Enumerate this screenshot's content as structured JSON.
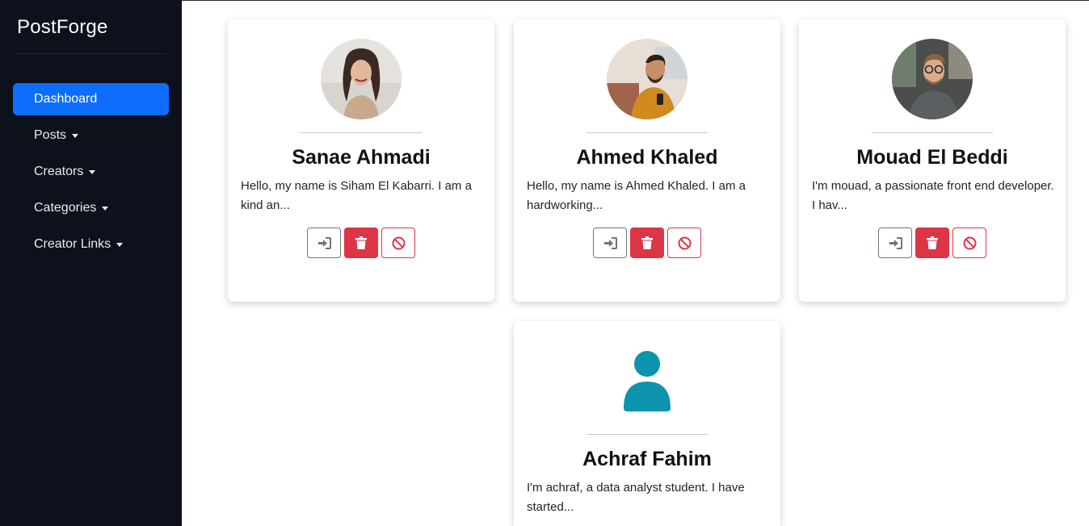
{
  "sidebar": {
    "brand": "PostForge",
    "items": [
      {
        "label": "Dashboard",
        "active": true,
        "has_caret": false
      },
      {
        "label": "Posts",
        "active": false,
        "has_caret": true
      },
      {
        "label": "Creators",
        "active": false,
        "has_caret": true
      },
      {
        "label": "Categories",
        "active": false,
        "has_caret": true
      },
      {
        "label": "Creator Links",
        "active": false,
        "has_caret": true
      }
    ]
  },
  "creators": [
    {
      "name": "Sanae Ahmadi",
      "description": "Hello, my name is Siham El Kabarri. I am a kind an...",
      "avatar": "photo-woman-smiling"
    },
    {
      "name": "Ahmed Khaled",
      "description": "Hello, my name is Ahmed Khaled. I am a hardworking...",
      "avatar": "photo-man-with-phone"
    },
    {
      "name": "Mouad El Beddi",
      "description": "I'm mouad, a passionate front end developer. I hav...",
      "avatar": "photo-man-with-glasses"
    },
    {
      "name": "Achraf Fahim",
      "description": "I'm achraf, a data analyst student. I have started...",
      "avatar": "default-user-icon"
    }
  ],
  "actions": {
    "login_icon": "sign-in-icon",
    "delete_icon": "trash-icon",
    "ban_icon": "ban-icon"
  },
  "colors": {
    "sidebar_bg": "#0c111b",
    "active_nav": "#0d6efd",
    "danger": "#dc3545",
    "secondary": "#6c757d",
    "default_avatar": "#0d94ae"
  }
}
